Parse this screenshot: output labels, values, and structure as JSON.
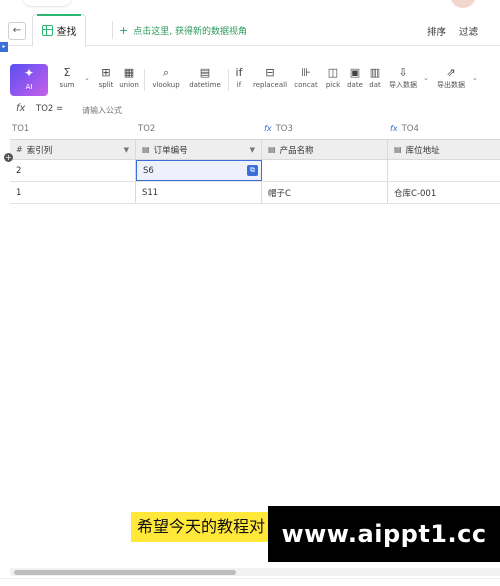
{
  "tabbar": {
    "back_icon": "←",
    "active_tab": "查找",
    "add_icon": "+",
    "add_view_text": "点击这里, 获得新的数据视角",
    "sort_label": "排序",
    "filter_label": "过滤",
    "side_marker": "▸"
  },
  "toolbar": {
    "ai": {
      "icon": "✦",
      "label": "AI"
    },
    "tools": [
      {
        "icon": "Σ",
        "label": "sum"
      },
      {
        "icon": "⊞",
        "label": "split"
      },
      {
        "icon": "▦",
        "label": "union"
      },
      {
        "icon": "⌕",
        "label": "vlookup"
      },
      {
        "icon": "▤",
        "label": "datetime"
      },
      {
        "icon": "if",
        "label": "if"
      },
      {
        "icon": "⊟",
        "label": "replaceall"
      },
      {
        "icon": "⊪",
        "label": "concat"
      },
      {
        "icon": "◫",
        "label": "pick"
      },
      {
        "icon": "▣",
        "label": "date"
      },
      {
        "icon": "▥",
        "label": "dat"
      },
      {
        "icon": "⇩",
        "label": "导入数据"
      },
      {
        "icon": "⇗",
        "label": "导出数据"
      }
    ],
    "caret": "⌄"
  },
  "formula_bar": {
    "fx": "fx",
    "field": "TO2 =",
    "placeholder": "请输入公式"
  },
  "table": {
    "col_ids": [
      "TO1",
      "TO2",
      "TO3",
      "TO4"
    ],
    "col_fx": "fx",
    "headers": [
      {
        "icon": "#",
        "label": "索引列"
      },
      {
        "icon": "▤",
        "label": "订单编号"
      },
      {
        "icon": "▤",
        "label": "产品名称"
      },
      {
        "icon": "▤",
        "label": "库位地址"
      }
    ],
    "dropdown": "▼",
    "rows": [
      [
        "2",
        "S6",
        "",
        ""
      ],
      [
        "1",
        "S11",
        "帽子C",
        "仓库C-001"
      ]
    ],
    "add_row_icon": "+",
    "selected_badge": "⧉"
  },
  "overlay": {
    "caption": "希望今天的教程对",
    "watermark": "www.aippt1.cc"
  }
}
